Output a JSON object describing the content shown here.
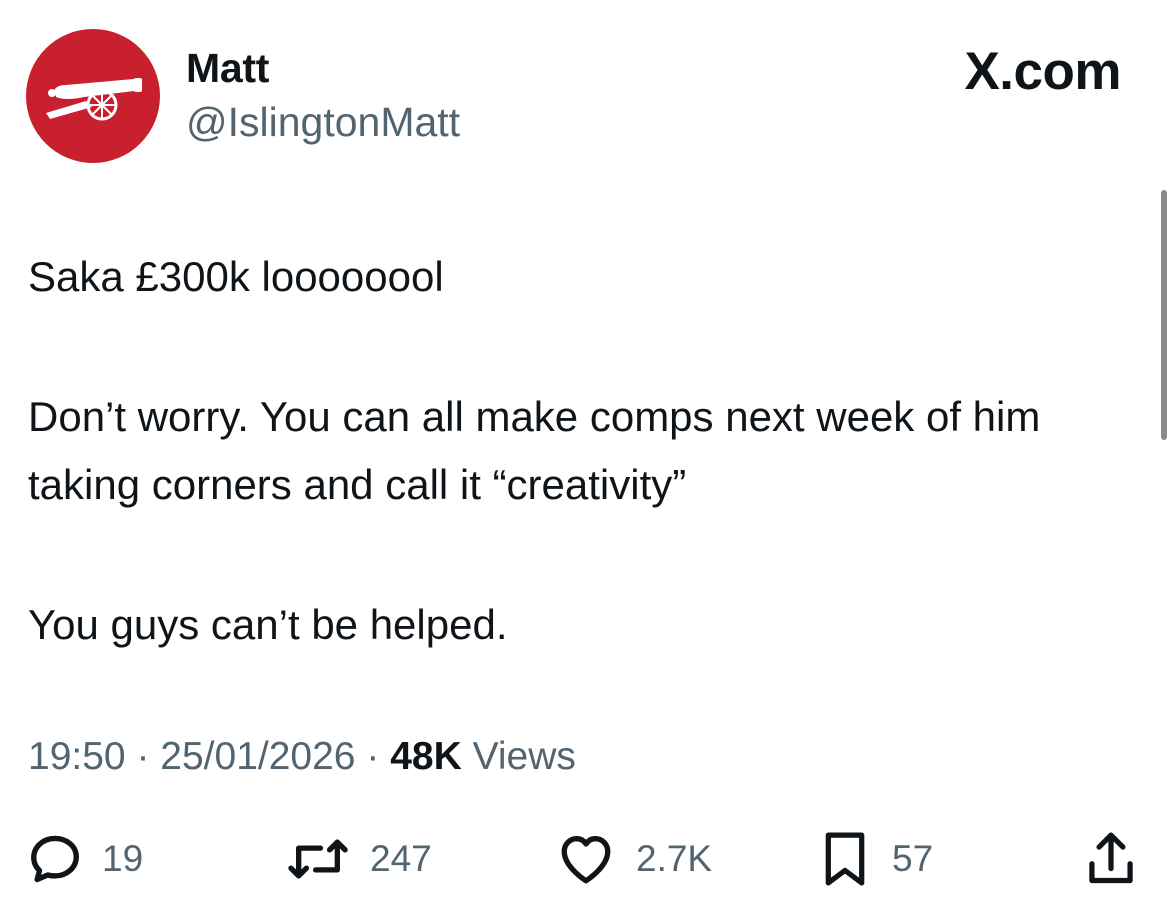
{
  "author": {
    "display_name": "Matt",
    "handle": "@IslingtonMatt",
    "avatar_icon": "arsenal-cannon-icon",
    "avatar_color": "#c8202f"
  },
  "brand": "X.com",
  "tweet": {
    "paragraphs": [
      "Saka £300k loooooool",
      "Don’t worry. You can all make comps next week of him taking corners and call it “creativity”",
      "You guys can’t be helped."
    ]
  },
  "meta": {
    "time": "19:50",
    "separator": "·",
    "date": "25/01/2026",
    "views_count": "48K",
    "views_label": "Views"
  },
  "actions": {
    "reply": {
      "icon": "reply-icon",
      "count": "19"
    },
    "repost": {
      "icon": "repost-icon",
      "count": "247"
    },
    "like": {
      "icon": "heart-icon",
      "count": "2.7K"
    },
    "bookmark": {
      "icon": "bookmark-icon",
      "count": "57"
    },
    "share": {
      "icon": "share-icon"
    }
  },
  "colors": {
    "text_primary": "#0f1419",
    "text_secondary": "#536471",
    "background": "#ffffff"
  }
}
